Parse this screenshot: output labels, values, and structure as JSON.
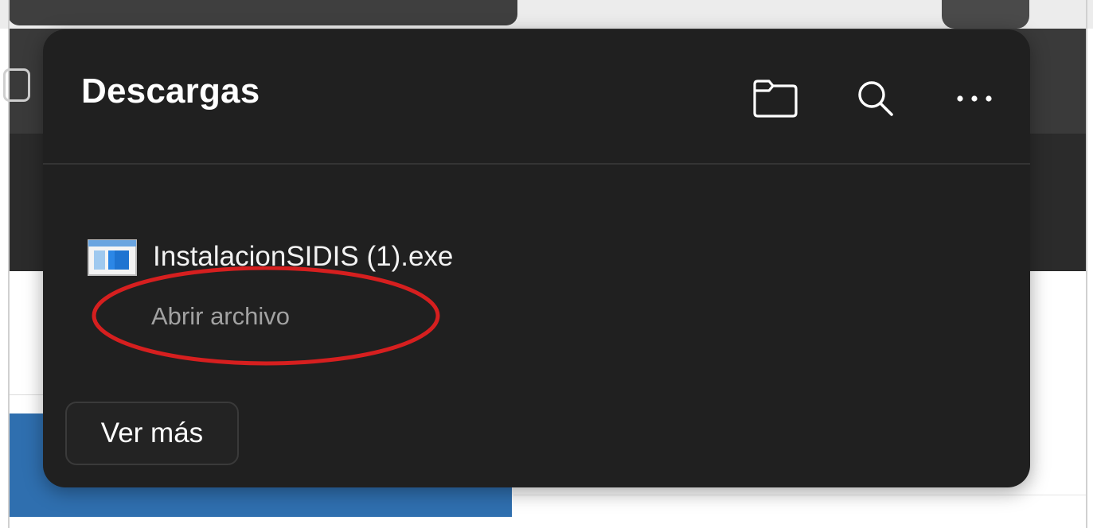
{
  "downloads_panel": {
    "title": "Descargas",
    "toolbar": {
      "open_folder_icon": "folder-icon",
      "search_icon": "search-icon",
      "more_icon": "more-options-icon"
    },
    "items": [
      {
        "file_name": "InstalacionSIDIS (1).exe",
        "action_label": "Abrir archivo",
        "icon": "exe-file-icon"
      }
    ],
    "footer": {
      "see_more_label": "Ver más"
    }
  },
  "colors": {
    "panel_background": "#202020",
    "panel_text": "#ffffff",
    "secondary_text": "#a2a2a2",
    "annotation_circle": "#d61f1f",
    "background_blue": "#2f6faf"
  }
}
